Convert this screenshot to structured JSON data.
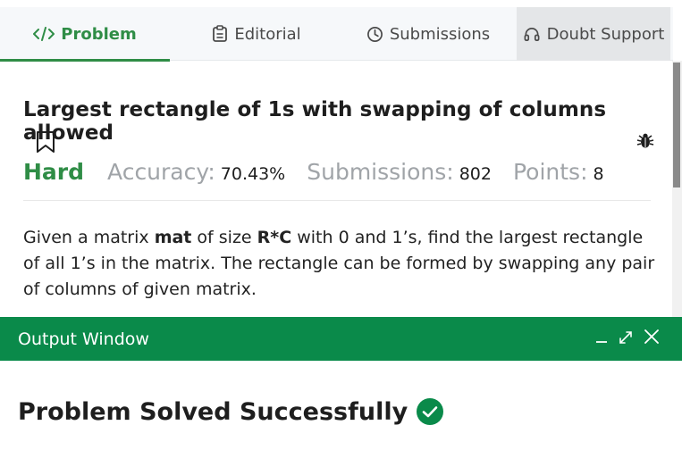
{
  "tabs": {
    "problem": "Problem",
    "editorial": "Editorial",
    "submissions": "Submissions",
    "doubt_support": "Doubt Support"
  },
  "problem": {
    "title": "Largest rectangle of 1s with swapping of columns allowed",
    "difficulty": "Hard",
    "accuracy_label": "Accuracy:",
    "accuracy_value": "70.43%",
    "submissions_label": "Submissions:",
    "submissions_value": "802",
    "points_label": "Points:",
    "points_value": "8",
    "description": {
      "p1": "Given a matrix ",
      "b1": "mat",
      "p2": " of size ",
      "b2": "R*C",
      "p3": " with 0 and 1’s, find the largest rectangle of all 1’s in the matrix. The rectangle can be formed by swapping any pair of columns of given matrix."
    }
  },
  "output": {
    "title": "Output Window",
    "result": "Problem Solved Successfully"
  },
  "colors": {
    "accent": "#2f8d46",
    "output_header": "#0a8a4a"
  },
  "icons": [
    "code-icon",
    "editorial-icon",
    "clock-icon",
    "headset-icon",
    "bookmark-icon",
    "bug-icon",
    "minimize-icon",
    "expand-icon",
    "close-icon",
    "check-circle-icon"
  ]
}
